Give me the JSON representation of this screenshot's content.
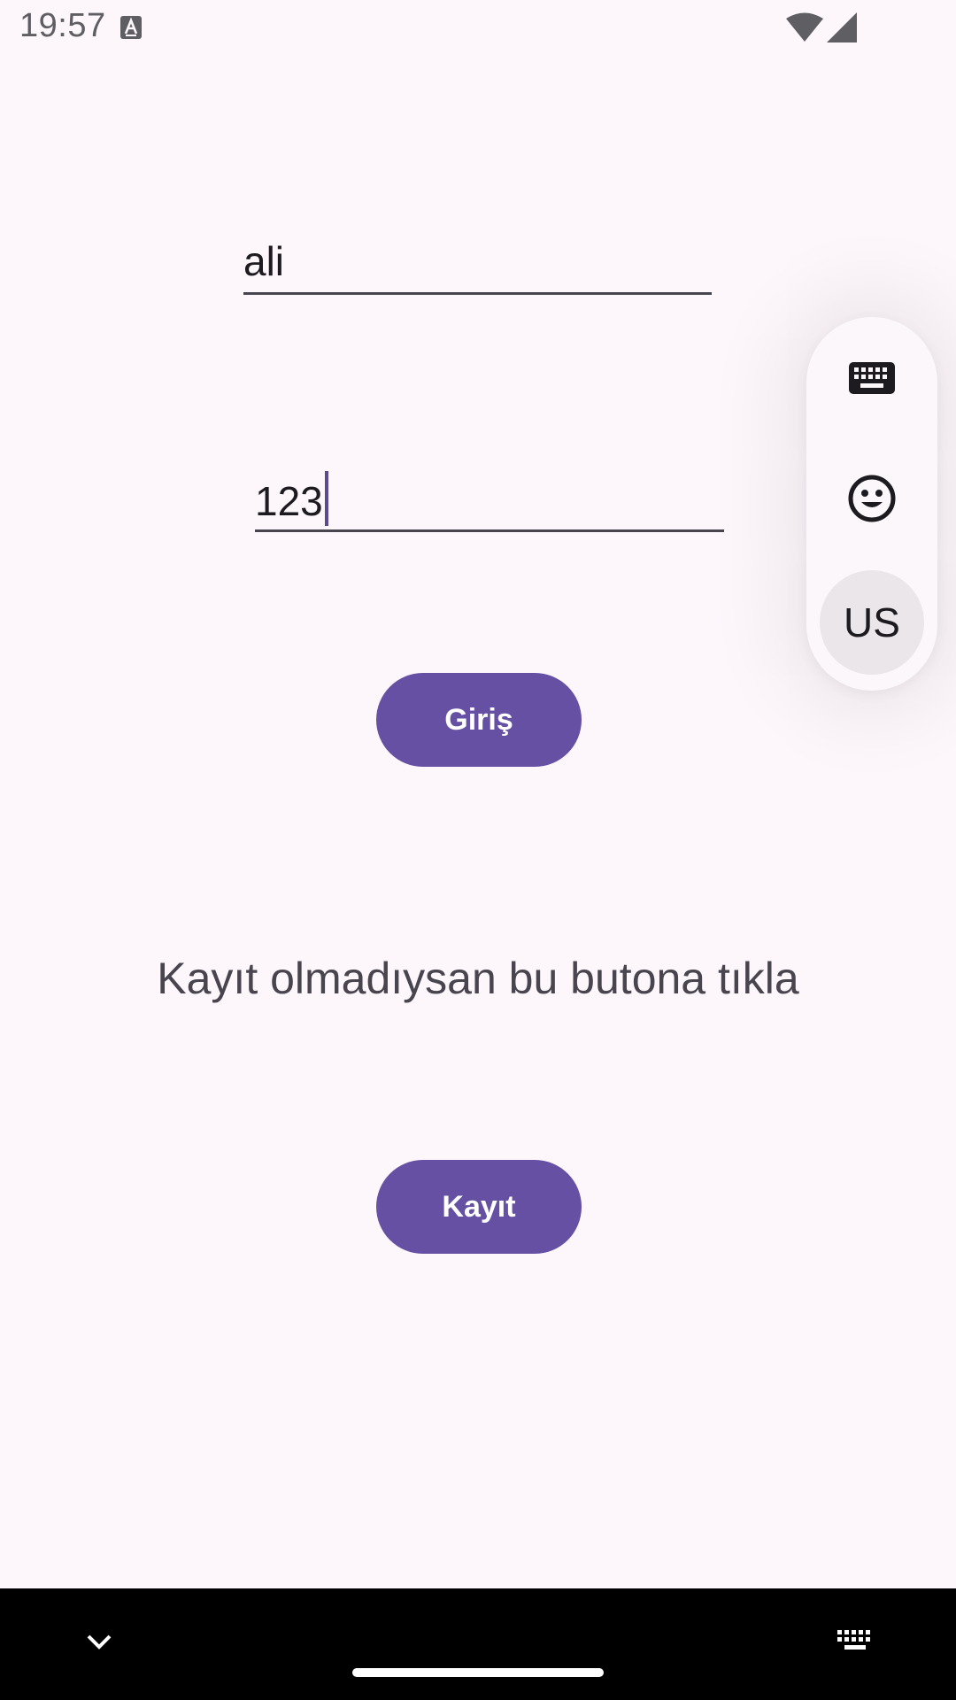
{
  "status_bar": {
    "time": "19:57",
    "icons": [
      "a-notification-icon",
      "wifi-icon",
      "signal-icon"
    ]
  },
  "login_form": {
    "username": {
      "value": "ali"
    },
    "password": {
      "value": "123"
    },
    "login_button": {
      "label": "Giriş"
    },
    "register_hint": "Kayıt olmadıysan bu butona tıkla",
    "register_button": {
      "label": "Kayıt"
    }
  },
  "ime_switcher": {
    "items": [
      "keyboard-icon",
      "emoji-icon"
    ],
    "language_label": "US"
  },
  "navigation_bar": {
    "icons": [
      "chevron-down-icon",
      "home-handle",
      "keyboard-icon"
    ]
  },
  "colors": {
    "background": "#FDF7FC",
    "accent": "#6650A4",
    "text_primary": "#1D1B20",
    "text_secondary": "#49454F"
  }
}
